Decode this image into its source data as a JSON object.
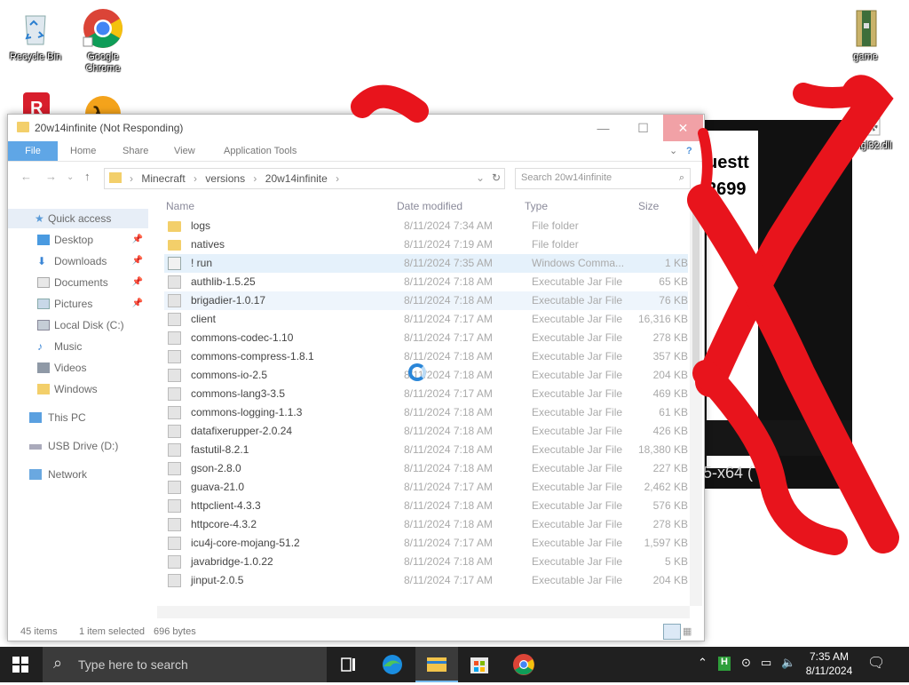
{
  "desktop": {
    "icons": [
      {
        "label": "Recycle Bin"
      },
      {
        "label": "Google Chrome"
      },
      {
        "label": "game"
      },
      {
        "label": "opengl32.dll"
      }
    ],
    "bg_text_1": "uestt",
    "bg_text_2": "2699",
    "bg_text_3": "5-x64 ("
  },
  "explorer": {
    "title": "20w14infinite (Not Responding)",
    "ribbon": [
      "File",
      "Home",
      "Share",
      "View",
      "Application Tools"
    ],
    "breadcrumb": [
      "Minecraft",
      "versions",
      "20w14infinite"
    ],
    "search_placeholder": "Search 20w14infinite",
    "nav": [
      {
        "label": "Quick access",
        "pinned": false
      },
      {
        "label": "Desktop",
        "pinned": true
      },
      {
        "label": "Downloads",
        "pinned": true
      },
      {
        "label": "Documents",
        "pinned": true
      },
      {
        "label": "Pictures",
        "pinned": true
      },
      {
        "label": "Local Disk (C:)",
        "pinned": false
      },
      {
        "label": "Music",
        "pinned": false
      },
      {
        "label": "Videos",
        "pinned": false
      },
      {
        "label": "Windows",
        "pinned": false
      },
      {
        "label": "This PC",
        "pinned": false
      },
      {
        "label": "USB Drive (D:)",
        "pinned": false
      },
      {
        "label": "Network",
        "pinned": false
      }
    ],
    "columns": [
      "Name",
      "Date modified",
      "Type",
      "Size"
    ],
    "files": [
      {
        "name": "logs",
        "date": "8/11/2024 7:34 AM",
        "type": "File folder",
        "size": "",
        "icon": "folder"
      },
      {
        "name": "natives",
        "date": "8/11/2024 7:19 AM",
        "type": "File folder",
        "size": "",
        "icon": "folder"
      },
      {
        "name": "! run",
        "date": "8/11/2024 7:35 AM",
        "type": "Windows Comma...",
        "size": "1 KB",
        "icon": "cmd"
      },
      {
        "name": "authlib-1.5.25",
        "date": "8/11/2024 7:18 AM",
        "type": "Executable Jar File",
        "size": "65 KB",
        "icon": "jar"
      },
      {
        "name": "brigadier-1.0.17",
        "date": "8/11/2024 7:18 AM",
        "type": "Executable Jar File",
        "size": "76 KB",
        "icon": "jar"
      },
      {
        "name": "client",
        "date": "8/11/2024 7:17 AM",
        "type": "Executable Jar File",
        "size": "16,316 KB",
        "icon": "jar"
      },
      {
        "name": "commons-codec-1.10",
        "date": "8/11/2024 7:17 AM",
        "type": "Executable Jar File",
        "size": "278 KB",
        "icon": "jar"
      },
      {
        "name": "commons-compress-1.8.1",
        "date": "8/11/2024 7:18 AM",
        "type": "Executable Jar File",
        "size": "357 KB",
        "icon": "jar"
      },
      {
        "name": "commons-io-2.5",
        "date": "8/11/2024 7:18 AM",
        "type": "Executable Jar File",
        "size": "204 KB",
        "icon": "jar"
      },
      {
        "name": "commons-lang3-3.5",
        "date": "8/11/2024 7:17 AM",
        "type": "Executable Jar File",
        "size": "469 KB",
        "icon": "jar"
      },
      {
        "name": "commons-logging-1.1.3",
        "date": "8/11/2024 7:18 AM",
        "type": "Executable Jar File",
        "size": "61 KB",
        "icon": "jar"
      },
      {
        "name": "datafixerupper-2.0.24",
        "date": "8/11/2024 7:18 AM",
        "type": "Executable Jar File",
        "size": "426 KB",
        "icon": "jar"
      },
      {
        "name": "fastutil-8.2.1",
        "date": "8/11/2024 7:18 AM",
        "type": "Executable Jar File",
        "size": "18,380 KB",
        "icon": "jar"
      },
      {
        "name": "gson-2.8.0",
        "date": "8/11/2024 7:18 AM",
        "type": "Executable Jar File",
        "size": "227 KB",
        "icon": "jar"
      },
      {
        "name": "guava-21.0",
        "date": "8/11/2024 7:17 AM",
        "type": "Executable Jar File",
        "size": "2,462 KB",
        "icon": "jar"
      },
      {
        "name": "httpclient-4.3.3",
        "date": "8/11/2024 7:18 AM",
        "type": "Executable Jar File",
        "size": "576 KB",
        "icon": "jar"
      },
      {
        "name": "httpcore-4.3.2",
        "date": "8/11/2024 7:18 AM",
        "type": "Executable Jar File",
        "size": "278 KB",
        "icon": "jar"
      },
      {
        "name": "icu4j-core-mojang-51.2",
        "date": "8/11/2024 7:17 AM",
        "type": "Executable Jar File",
        "size": "1,597 KB",
        "icon": "jar"
      },
      {
        "name": "javabridge-1.0.22",
        "date": "8/11/2024 7:18 AM",
        "type": "Executable Jar File",
        "size": "5 KB",
        "icon": "jar"
      },
      {
        "name": "jinput-2.0.5",
        "date": "8/11/2024 7:17 AM",
        "type": "Executable Jar File",
        "size": "204 KB",
        "icon": "jar"
      }
    ],
    "status": {
      "count": "45 items",
      "selected": "1 item selected",
      "bytes": "696 bytes"
    }
  },
  "taskbar": {
    "search_placeholder": "Type here to search",
    "time": "7:35 AM",
    "date": "8/11/2024"
  },
  "colors": {
    "accent": "#5fa6e6",
    "scribble": "#e8141c",
    "taskbar": "#202020"
  }
}
